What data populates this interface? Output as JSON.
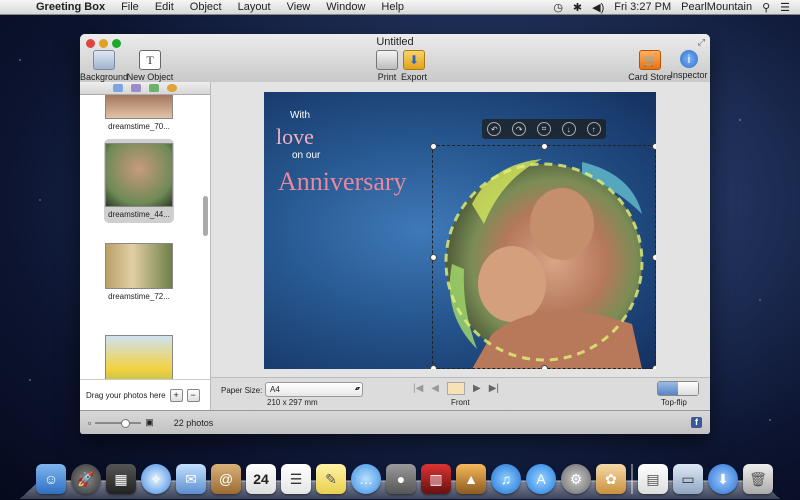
{
  "menubar": {
    "app_name": "Greeting Box",
    "items": [
      "File",
      "Edit",
      "Object",
      "Layout",
      "View",
      "Window",
      "Help"
    ],
    "clock": "Fri 3:27 PM",
    "user": "PearlMountain"
  },
  "window": {
    "title": "Untitled",
    "toolbar": {
      "background": "Background",
      "new_object": "New Object",
      "print": "Print",
      "export": "Export",
      "card_store": "Card Store",
      "inspector": "Inspector"
    }
  },
  "sidebar": {
    "thumbnails": [
      {
        "label": "dreamstime_70...",
        "selected": false
      },
      {
        "label": "dreamstime_44...",
        "selected": true
      },
      {
        "label": "dreamstime_72...",
        "selected": false
      },
      {
        "label": "",
        "selected": false
      }
    ],
    "drag_hint": "Drag your photos here",
    "add": "+",
    "remove": "−"
  },
  "card": {
    "line1": "With",
    "line2": "love",
    "line3": "on our",
    "line4": "Anniversary"
  },
  "controls": {
    "paper_size_label": "Paper Size:",
    "paper_size_value": "A4",
    "dimensions": "210 x 297 mm",
    "page_label": "Front",
    "flip_label": "Top-flip"
  },
  "status": {
    "photo_count": "22 photos"
  },
  "colors": {
    "card_text_pink": "#e8879e",
    "selection_accent": "#5a84c5"
  }
}
